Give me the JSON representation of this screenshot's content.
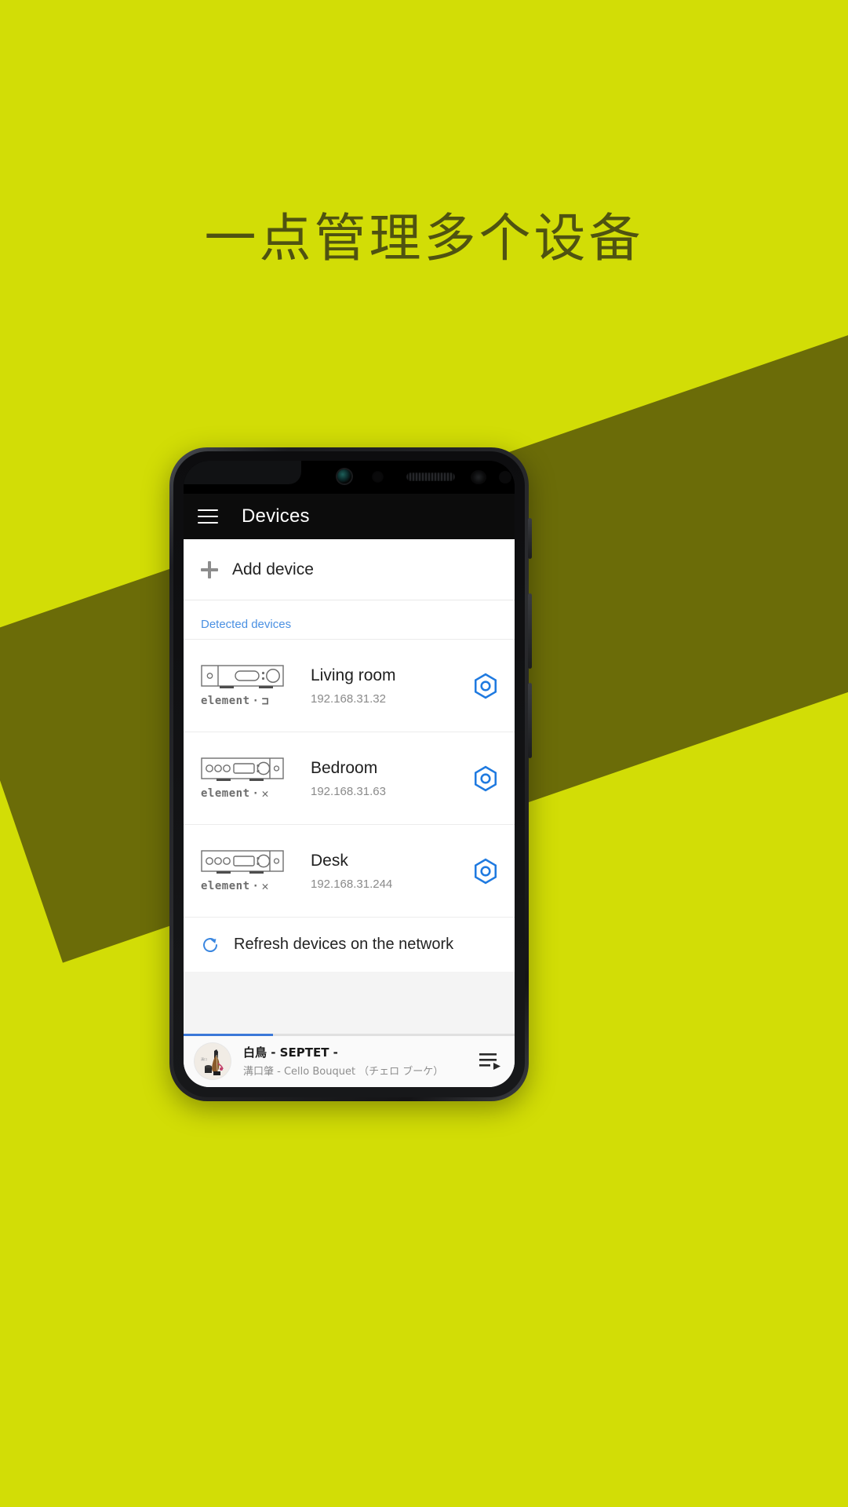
{
  "page": {
    "headline": "一点管理多个设备",
    "background_color": "#d2dd06",
    "band_color": "#6b6c08",
    "headline_color": "#4f5211"
  },
  "appbar": {
    "menu_icon": "hamburger-menu-icon",
    "title": "Devices"
  },
  "content": {
    "add_device": {
      "icon": "plus-icon",
      "label": "Add device"
    },
    "section_label": "Detected devices",
    "section_label_color": "#4a90e2",
    "devices": [
      {
        "name": "Living room",
        "ip": "192.168.31.32",
        "brand": "element",
        "brand_glyph": "⊐",
        "icon": "device-amplifier-icon",
        "settings_icon": "hex-gear-icon",
        "variant": "slim"
      },
      {
        "name": "Bedroom",
        "ip": "192.168.31.63",
        "brand": "element",
        "brand_glyph": "✕",
        "icon": "device-receiver-icon",
        "settings_icon": "hex-gear-icon",
        "variant": "wide"
      },
      {
        "name": "Desk",
        "ip": "192.168.31.244",
        "brand": "element",
        "brand_glyph": "✕",
        "icon": "device-receiver-icon",
        "settings_icon": "hex-gear-icon",
        "variant": "wide"
      }
    ],
    "refresh": {
      "icon": "refresh-icon",
      "label": "Refresh devices on the network",
      "icon_color": "#3b87e0"
    }
  },
  "now_playing": {
    "title": "白鳥 - SEPTET -",
    "subtitle": "溝口肇 - Cello Bouquet （チェロ ブーケ）",
    "album_art": "cello-album-art",
    "queue_icon": "playlist-queue-icon",
    "progress_percent": 27,
    "progress_color": "#3b78d8"
  },
  "accent": {
    "blue": "#1a73e8",
    "gear_blue": "#1f7ae0"
  }
}
